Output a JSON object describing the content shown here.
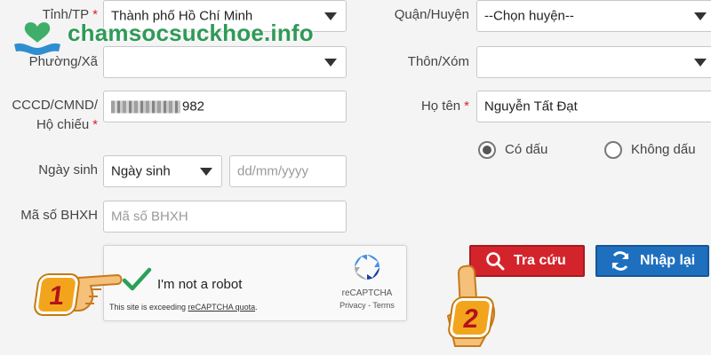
{
  "watermark": {
    "text": "chamsocsuckhoe.info"
  },
  "form": {
    "province": {
      "label": "Tỉnh/TP",
      "required_mark": "*",
      "value": "Thành phố Hồ Chí Minh"
    },
    "district": {
      "label": "Quận/Huyện",
      "value": "--Chọn huyện--"
    },
    "ward": {
      "label": "Phường/Xã",
      "value": ""
    },
    "village": {
      "label": "Thôn/Xóm",
      "value": ""
    },
    "id_number": {
      "label_line1": "CCCD/CMND/",
      "label_line2": "Hộ chiếu",
      "required_mark": "*",
      "value_visible": "982"
    },
    "full_name": {
      "label": "Họ tên",
      "required_mark": "*",
      "value": "Nguyễn Tất Đạt"
    },
    "accent": {
      "option_accented": "Có dấu",
      "option_unaccented": "Không dấu",
      "selected": "Có dấu"
    },
    "dob": {
      "label": "Ngày sinh",
      "select_value": "Ngày sinh",
      "placeholder": "dd/mm/yyyy"
    },
    "bhxh": {
      "label": "Mã số BHXH",
      "placeholder": "Mã số BHXH"
    }
  },
  "captcha": {
    "checkbox_label": "I'm not a robot",
    "notice_prefix": "This site is exceeding",
    "notice_link": "reCAPTCHA quota",
    "notice_suffix": ".",
    "brand": "reCAPTCHA",
    "privacy": "Privacy",
    "separator": " - ",
    "terms": "Terms"
  },
  "buttons": {
    "search": "Tra cứu",
    "reset": "Nhập lại"
  },
  "callouts": {
    "step1": "1",
    "step2": "2"
  },
  "colors": {
    "accent_red": "#d4242b",
    "accent_blue": "#1f6fbf",
    "watermark_green": "#2f9a57",
    "callout_orange": "#f2a51c"
  }
}
